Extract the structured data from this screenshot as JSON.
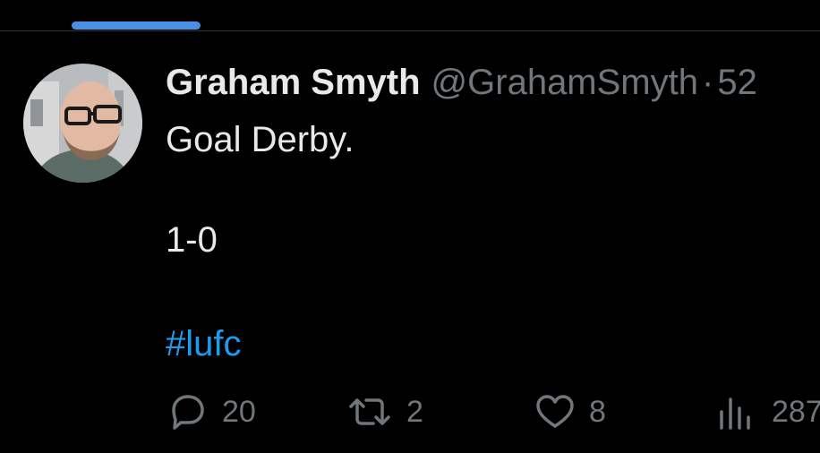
{
  "post": {
    "author_name": "Graham Smyth",
    "author_handle": "@GrahamSmyth",
    "separator": "·",
    "time": "52",
    "text_line_1": "Goal Derby.",
    "text_line_2": "1-0",
    "hashtag": "#lufc"
  },
  "actions": {
    "reply_count": "20",
    "repost_count": "2",
    "like_count": "8",
    "view_count": "287"
  },
  "icons": {
    "reply": "reply-bubble-icon",
    "repost": "repost-icon",
    "like": "heart-icon",
    "views": "views-bar-chart-icon"
  },
  "colors": {
    "background": "#000000",
    "text": "#e7e9ea",
    "secondary": "#71767b",
    "link": "#1d9bf0",
    "tab_indicator": "#4a90e2"
  }
}
